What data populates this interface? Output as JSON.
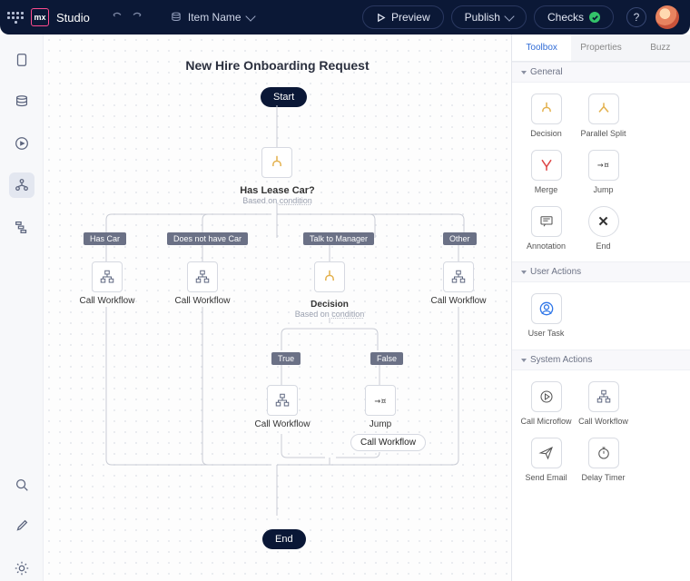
{
  "header": {
    "logo": "mx",
    "title": "Studio",
    "item_name": "Item Name",
    "preview": "Preview",
    "publish": "Publish",
    "checks": "Checks"
  },
  "leftnav": {
    "active_index": 3
  },
  "workflow": {
    "title": "New Hire Onboarding Request",
    "start": "Start",
    "end": "End",
    "decision1": {
      "label": "Has Lease Car?",
      "sub_prefix": "Based on ",
      "sub_underline": "condition"
    },
    "decision2": {
      "label": "Decision",
      "sub_prefix": "Based on ",
      "sub_underline": "condition"
    },
    "branches1": [
      "Has Car",
      "Does not have Car",
      "Talk to Manager",
      "Other"
    ],
    "branches2": [
      "True",
      "False"
    ],
    "call_workflow_label": "Call Workflow",
    "jump_label": "Jump",
    "jump_target": "Call Workflow"
  },
  "rightpanel": {
    "tabs": [
      "Toolbox",
      "Properties",
      "Buzz"
    ],
    "general_header": "General",
    "useractions_header": "User Actions",
    "systemactions_header": "System Actions",
    "tools": {
      "decision": "Decision",
      "parallel_split": "Parallel Split",
      "merge": "Merge",
      "jump": "Jump",
      "annotation": "Annotation",
      "end": "End",
      "user_task": "User Task",
      "call_microflow": "Call Microflow",
      "call_workflow": "Call Workflow",
      "send_email": "Send Email",
      "delay_timer": "Delay Timer"
    }
  }
}
